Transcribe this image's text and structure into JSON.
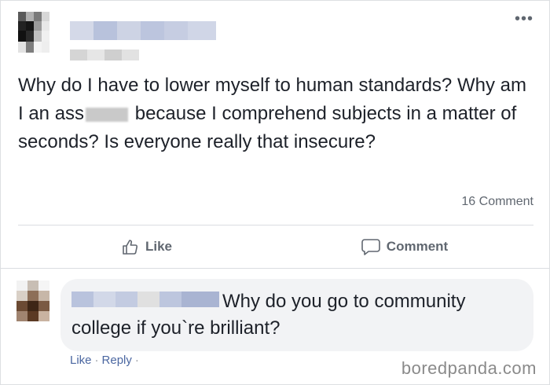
{
  "post": {
    "text_part1": "Why do I have to lower myself to human standards? Why am I an ass",
    "text_part2": "because I comprehend subjects in a matter of seconds? Is everyone really that insecure?",
    "comment_count": "16 Comment",
    "more_icon": "more-options-icon"
  },
  "actions": {
    "like_label": "Like",
    "comment_label": "Comment"
  },
  "comment": {
    "text": "Why do you go to community college if you`re brilliant?",
    "like_link": "Like",
    "separator": "·",
    "reply_link": "Reply",
    "trailing": "·"
  },
  "watermark": "boredpanda.com",
  "colors": {
    "text": "#1d2129",
    "muted": "#606770",
    "link": "#4b67a1",
    "bubble": "#f2f3f5",
    "divider": "#dadde1"
  }
}
